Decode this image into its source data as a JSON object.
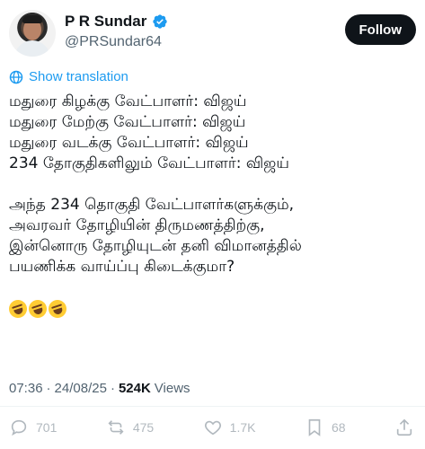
{
  "author": {
    "display_name": "P R Sundar",
    "handle": "@PRSundar64"
  },
  "follow_label": "Follow",
  "translate_label": "Show translation",
  "tweet": {
    "lines": [
      "மதுரை கிழக்கு வேட்பாளர்: விஜய்",
      "மதுரை மேற்கு வேட்பாளர்: விஜய்",
      "மதுரை வடக்கு வேட்பாளர்: விஜய்",
      "234 தோகுதிகளிலும் வேட்பாளர்: விஜய்",
      "அந்த 234 தொகுதி வேட்பாளர்களுக்கும்,",
      "அவரவர் தோழியின் திருமணத்திற்கு,",
      "இன்னொரு தோழியுடன் தனி விமானத்தில்",
      "பயணிக்க வாய்ப்பு கிடைக்குமா?"
    ],
    "emoji_count": 3
  },
  "meta": {
    "time": "07:36",
    "separator": "·",
    "date": "24/08/25",
    "separator2": "·",
    "views_count": "524K",
    "views_label": "Views"
  },
  "actions": {
    "replies": "701",
    "reposts": "475",
    "likes": "1.7K",
    "bookmarks": "68"
  },
  "colors": {
    "accent": "#1d9bf0",
    "text": "#0f1419",
    "muted": "#536471"
  }
}
